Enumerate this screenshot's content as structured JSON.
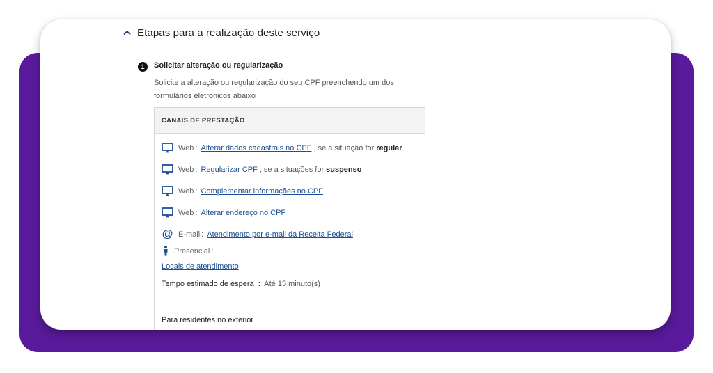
{
  "section": {
    "title": "Etapas para a realização deste serviço"
  },
  "step": {
    "number": "1",
    "title": "Solicitar alteração ou regularização",
    "description": "Solicite a alteração ou regularização do seu CPF preenchendo um dos formulários eletrônicos abaixo"
  },
  "channels": {
    "heading": "CANAIS DE PRESTAÇÃO",
    "web_items": [
      {
        "type": "Web",
        "link": "Alterar dados cadastrais no CPF",
        "suffix": ", se a situação for",
        "bold": "regular",
        "icon": "monitor-icon"
      },
      {
        "type": "Web",
        "link": "Regularizar CPF",
        "suffix": ", se a situações for",
        "bold": "suspenso",
        "icon": "monitor-icon"
      },
      {
        "type": "Web",
        "link": "Complementar informações no CPF",
        "suffix": "",
        "bold": "",
        "icon": "monitor-icon"
      },
      {
        "type": "Web",
        "link": "Alterar endereço no CPF",
        "suffix": "",
        "bold": "",
        "icon": "monitor-icon"
      }
    ],
    "email": {
      "type": "E-mail",
      "link": "Atendimento por e-mail da Receita Federal",
      "icon": "at-icon"
    },
    "presencial": {
      "type": "Presencial",
      "icon": "person-icon"
    },
    "locais_link": "Locais de atendimento",
    "wait": {
      "label": "Tempo estimado de espera",
      "value": "Até 15 minuto(s)"
    },
    "exterior": "Para residentes no exterior"
  },
  "colors": {
    "frame": "#5a1a9c",
    "link": "#1e4f93",
    "icon": "#1e4f93"
  }
}
